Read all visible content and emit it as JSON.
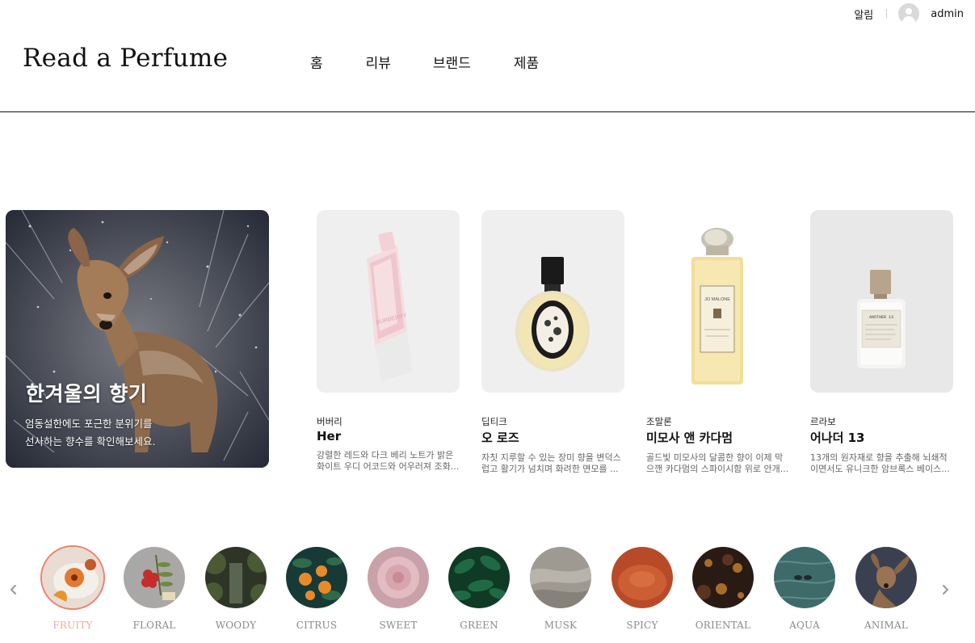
{
  "utility": {
    "alarm": "알림",
    "user": "admin"
  },
  "header": {
    "logo": "Read a Perfume",
    "nav": [
      {
        "label": "홈"
      },
      {
        "label": "리뷰"
      },
      {
        "label": "브랜드"
      },
      {
        "label": "제품"
      }
    ]
  },
  "hero": {
    "title": "한겨울의 향기",
    "desc_line1": "엄동설한에도 포근한 분위기를",
    "desc_line2": "선사하는 향수를 확인해보세요."
  },
  "products": [
    {
      "brand": "버버리",
      "name": "Her",
      "desc": "강렬한 레드와 다크 베리 노트가 밝은 화이트 우디 어코드와 어우러져 조화..."
    },
    {
      "brand": "딥티크",
      "name": "오 로즈",
      "desc": "자칫 지루할 수 있는 장미 향을 변덕스럽고 활기가 넘치며 화려한 면모를 ..."
    },
    {
      "brand": "조말론",
      "name": "미모사 앤 카다멈",
      "desc": "골드빛 미모사의 달콤한 향이 이제 막 으깬 카다멈의 스파이시함 위로 안개..."
    },
    {
      "brand": "르라보",
      "name": "어나더 13",
      "desc": "13개의 원자재로 향을 추출해 뇌쇄적이면서도 유니크한 암브록스 베이스..."
    }
  ],
  "categories": [
    {
      "label": "FRUITY",
      "active": true
    },
    {
      "label": "FLORAL"
    },
    {
      "label": "WOODY"
    },
    {
      "label": "CITRUS"
    },
    {
      "label": "SWEET"
    },
    {
      "label": "GREEN"
    },
    {
      "label": "MUSK"
    },
    {
      "label": "SPICY"
    },
    {
      "label": "ORIENTAL"
    },
    {
      "label": "AQUA"
    },
    {
      "label": "ANIMAL"
    }
  ],
  "colors": {
    "accent": "#f0806c",
    "accent_text": "#f7a79a",
    "divider": "#111111",
    "card_bg": "#efefef"
  },
  "icons": {
    "prev": "chevron-left-icon",
    "next": "chevron-right-icon",
    "avatar": "user-avatar-icon"
  }
}
